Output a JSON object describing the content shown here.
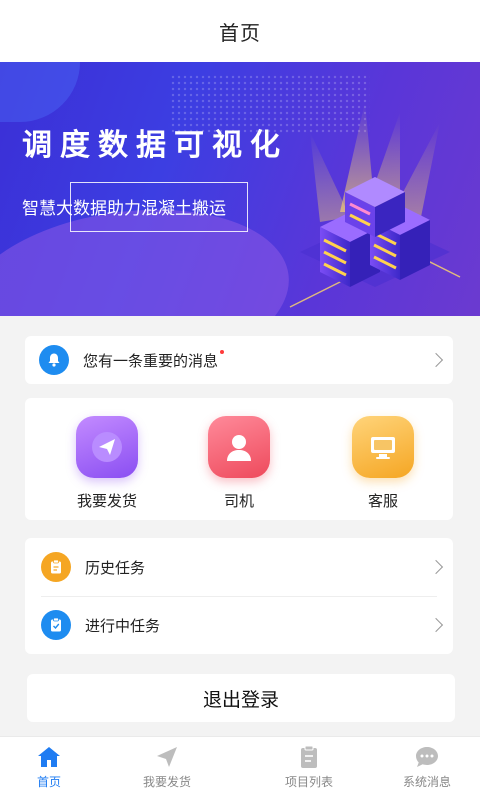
{
  "header": {
    "title": "首页"
  },
  "banner": {
    "headline": "调度数据可视化",
    "subtitle": "智慧大数据助力混凝土搬运"
  },
  "notice": {
    "text": "您有一条重要的消息"
  },
  "quick_actions": [
    {
      "label": "我要发货",
      "icon": "send-icon",
      "color": "#9b5cf6"
    },
    {
      "label": "司机",
      "icon": "driver-icon",
      "color": "#f05567"
    },
    {
      "label": "客服",
      "icon": "customer-service-icon",
      "color": "#f7b23a"
    }
  ],
  "tasks": [
    {
      "label": "历史任务",
      "icon": "clipboard-icon",
      "color": "#f5a623"
    },
    {
      "label": "进行中任务",
      "icon": "clipboard-check-icon",
      "color": "#1e8cf0"
    }
  ],
  "logout": {
    "label": "退出登录"
  },
  "tabs": [
    {
      "label": "首页",
      "icon": "home-icon",
      "active": true
    },
    {
      "label": "我要发货",
      "icon": "send-icon",
      "active": false
    },
    {
      "label": "项目列表",
      "icon": "list-icon",
      "active": false
    },
    {
      "label": "系统消息",
      "icon": "message-icon",
      "active": false
    }
  ],
  "colors": {
    "primary": "#1f7cf2",
    "tab_inactive": "#888888",
    "banner_start": "#3b2fd6",
    "banner_end": "#6b3ad0"
  }
}
